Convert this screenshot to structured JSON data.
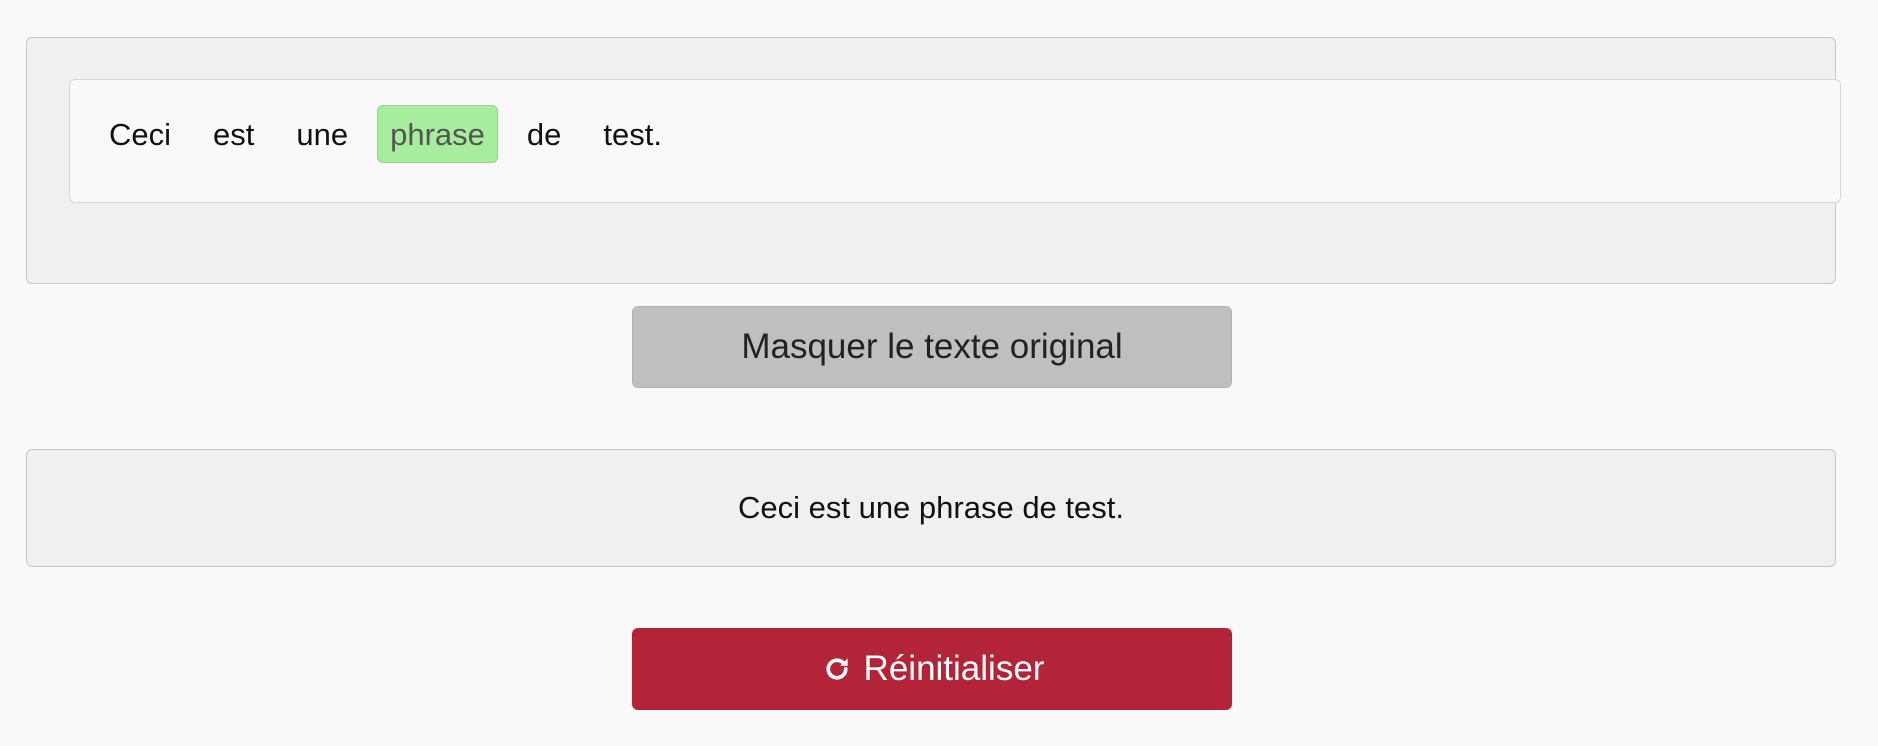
{
  "words": [
    "Ceci",
    "est",
    "une",
    "phrase",
    "de",
    "test."
  ],
  "selected_word_index": 3,
  "toggle_button": {
    "label": "Masquer le texte original"
  },
  "original": {
    "text": "Ceci est une phrase de test."
  },
  "reset_button": {
    "label": "Réinitialiser",
    "icon": "rotate-right-icon"
  },
  "colors": {
    "selected_word": "#a6ee9d",
    "reset_button": "#b32438",
    "toggle_button": "#bfbfbf"
  }
}
